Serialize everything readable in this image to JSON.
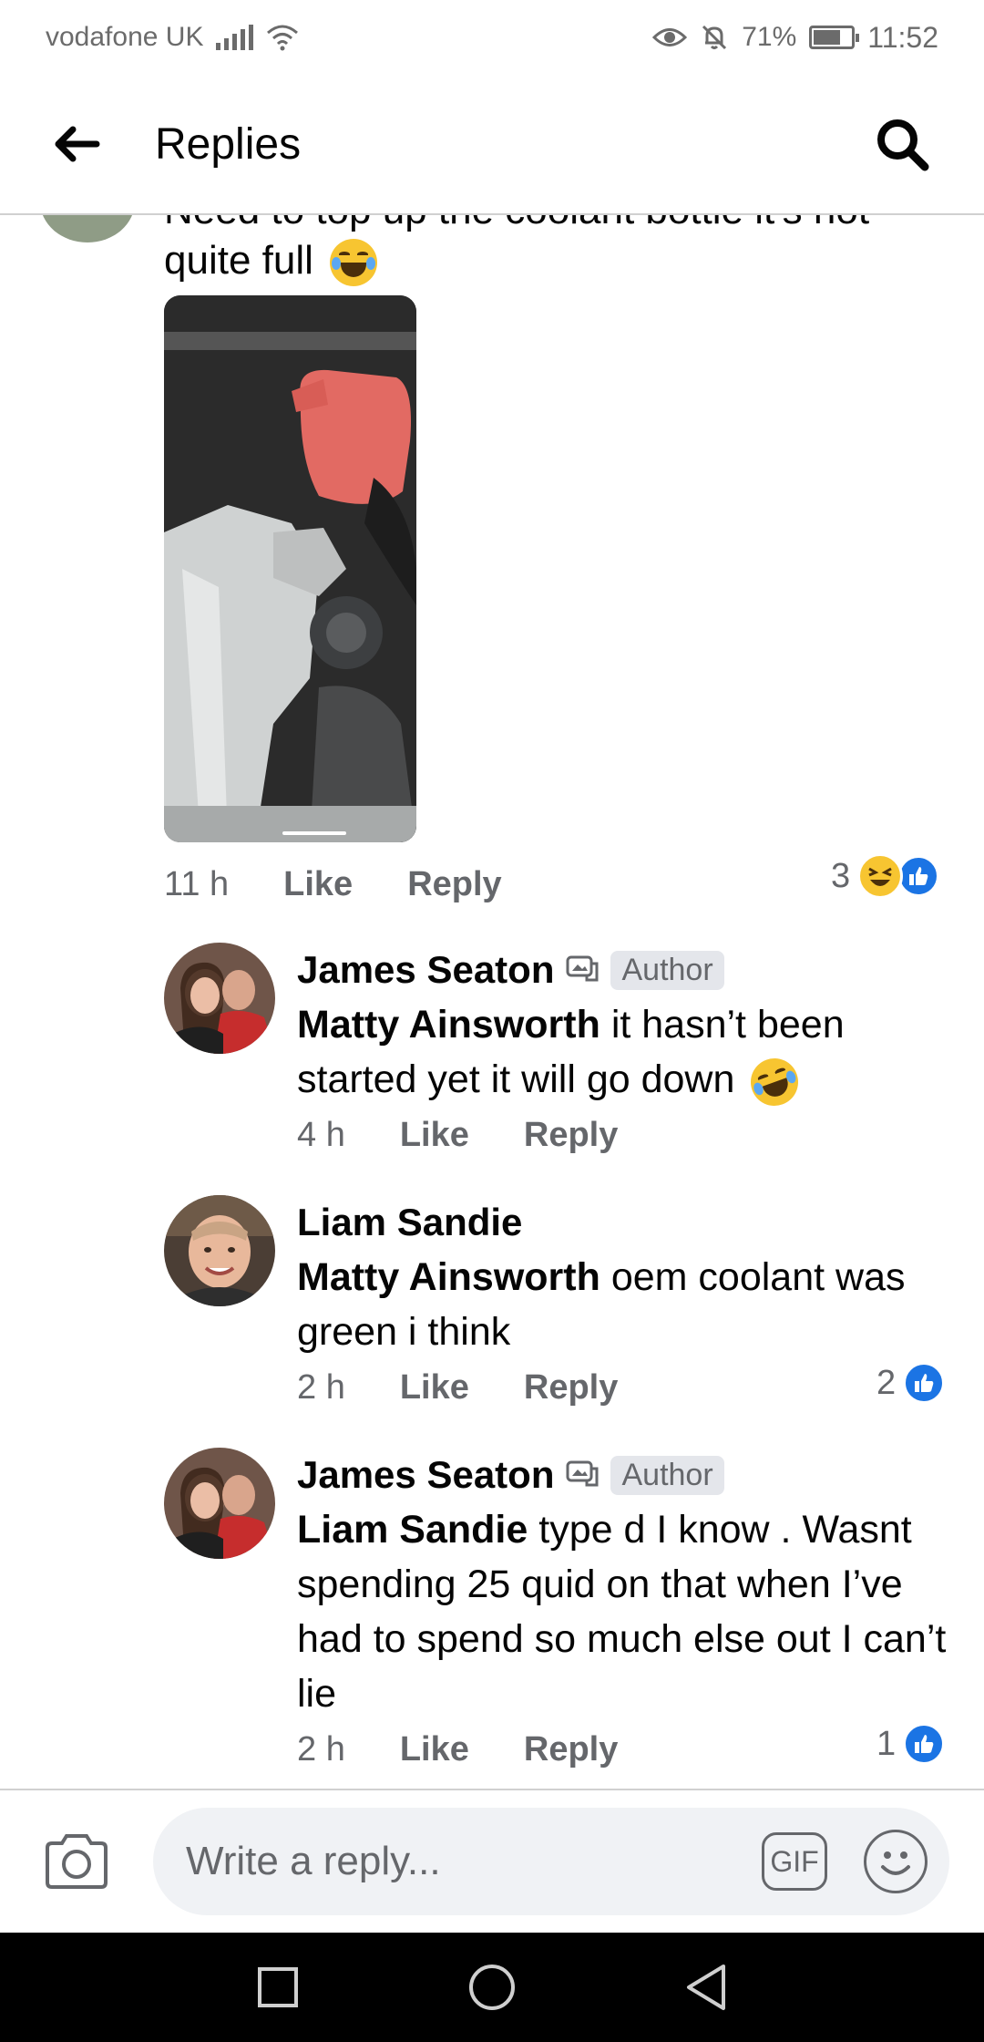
{
  "status_bar": {
    "carrier": "vodafone UK",
    "battery": "71%",
    "time": "11:52"
  },
  "header": {
    "title": "Replies"
  },
  "parent_comment": {
    "text_cut": "Need to top up the coolant bottle it's not",
    "text": "quite full",
    "time": "11 h",
    "like_label": "Like",
    "reply_label": "Reply",
    "reaction_count": "3"
  },
  "replies": [
    {
      "name": "James Seaton",
      "badge": "Author",
      "mention": "Matty Ainsworth",
      "text": "it hasn’t been started yet it will go down",
      "time": "4 h",
      "like_label": "Like",
      "reply_label": "Reply"
    },
    {
      "name": "Liam Sandie",
      "mention": "Matty Ainsworth",
      "text": "oem coolant was green i think",
      "time": "2 h",
      "like_label": "Like",
      "reply_label": "Reply",
      "reaction_count": "2"
    },
    {
      "name": "James Seaton",
      "badge": "Author",
      "mention": "Liam Sandie",
      "text": "type d I know . Wasnt spending 25 quid on that when I’ve had to spend so much else out I can’t lie",
      "time": "2 h",
      "like_label": "Like",
      "reply_label": "Reply",
      "reaction_count": "1"
    }
  ],
  "composer": {
    "placeholder": "Write a reply...",
    "gif_label": "GIF"
  },
  "colors": {
    "like_blue": "#1b74e4",
    "meta_gray": "#65676b"
  }
}
